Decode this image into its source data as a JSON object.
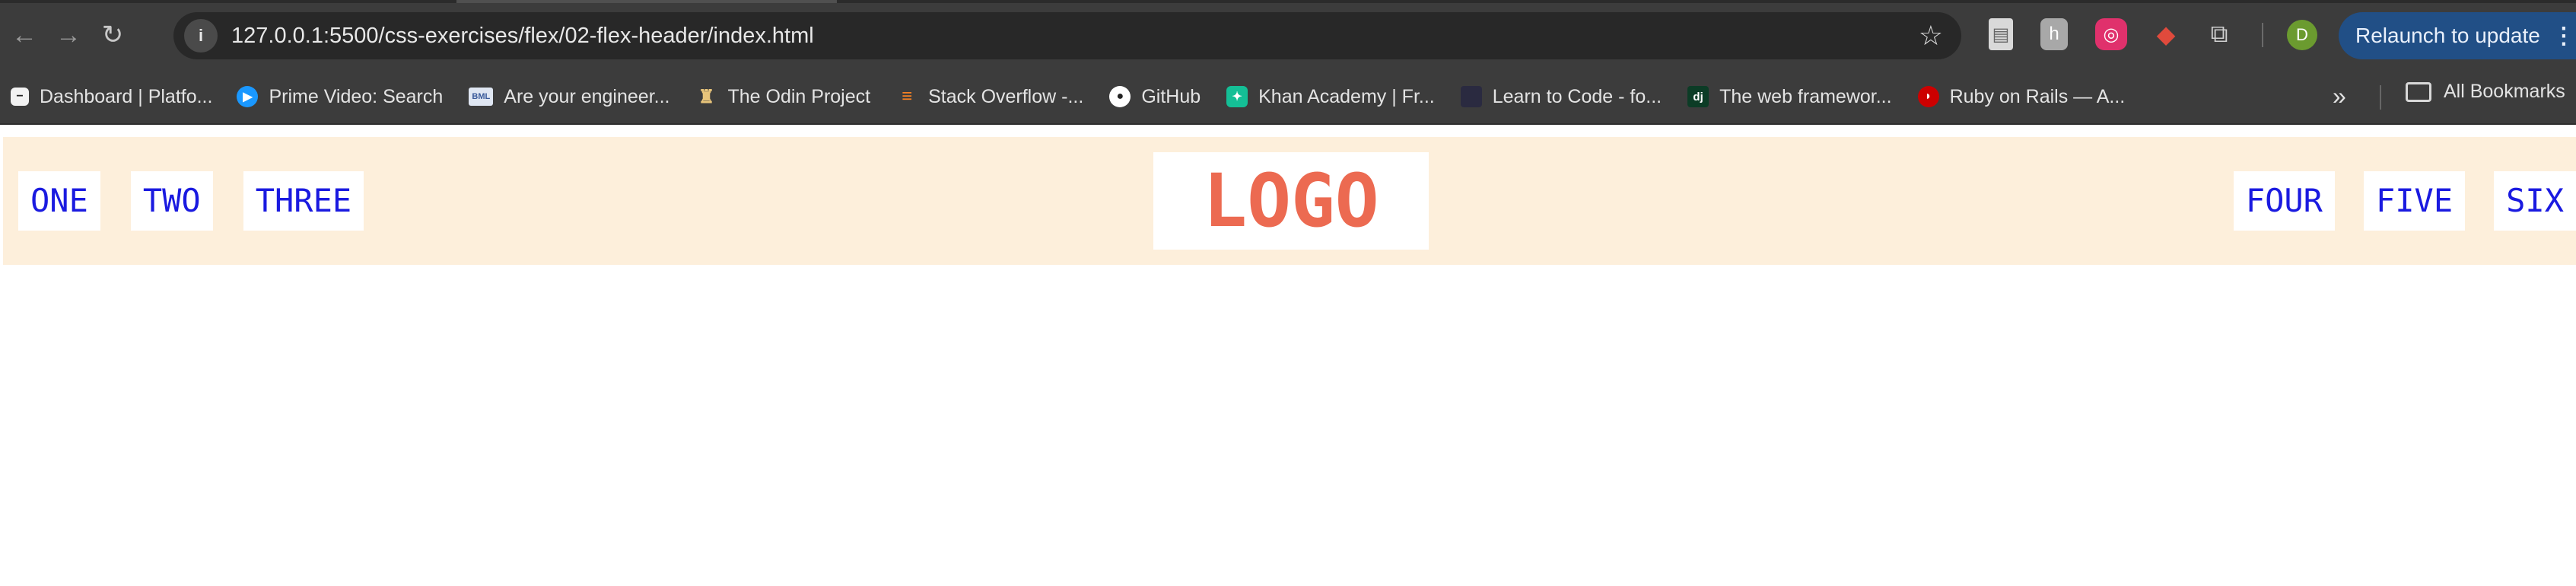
{
  "browser": {
    "url": "127.0.0.1:5500/css-exercises/flex/02-flex-header/index.html",
    "relaunch_label": "Relaunch to update",
    "profile_initial": "D",
    "accent": "#214f86",
    "bookmarks": [
      {
        "label": "Dashboard | Platfo...",
        "icon": "dashboard-icon"
      },
      {
        "label": "Prime Video: Search",
        "icon": "prime-video-icon"
      },
      {
        "label": "Are your engineer...",
        "icon": "bml-icon"
      },
      {
        "label": "The Odin Project",
        "icon": "odin-icon"
      },
      {
        "label": "Stack Overflow -...",
        "icon": "stackoverflow-icon"
      },
      {
        "label": "GitHub",
        "icon": "github-icon"
      },
      {
        "label": "Khan Academy | Fr...",
        "icon": "khan-academy-icon"
      },
      {
        "label": "Learn to Code - fo...",
        "icon": "freecodecamp-icon"
      },
      {
        "label": "The web framewor...",
        "icon": "django-icon"
      },
      {
        "label": "Ruby on Rails — A...",
        "icon": "rails-icon"
      }
    ],
    "all_bookmarks_label": "All Bookmarks"
  },
  "header": {
    "left_links": [
      "ONE",
      "TWO",
      "THREE"
    ],
    "logo": "LOGO",
    "right_links": [
      "FOUR",
      "FIVE",
      "SIX"
    ],
    "background": "#fdefdb",
    "link_color": "#1a1ae0",
    "logo_color": "#ec6a51"
  }
}
